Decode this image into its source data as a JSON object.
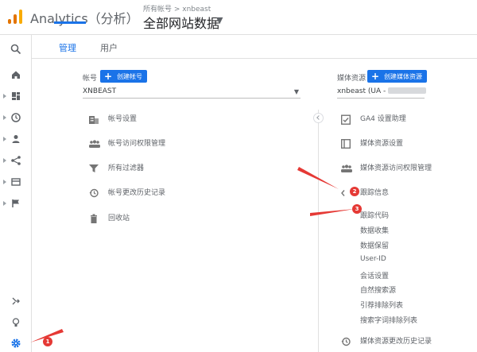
{
  "header": {
    "app_name": "Analytics（分析）",
    "breadcrumb": "所有帐号 > xnbeast",
    "view_name": "全部网站数据"
  },
  "tabs": [
    {
      "label": "管理"
    },
    {
      "label": "用户"
    }
  ],
  "account": {
    "label": "帐号",
    "create_label": "创建帐号",
    "selected": "XNBEAST",
    "items": [
      {
        "label": "帐号设置",
        "icon": "building-icon"
      },
      {
        "label": "帐号访问权限管理",
        "icon": "users-icon"
      },
      {
        "label": "所有过滤器",
        "icon": "filter-icon"
      },
      {
        "label": "帐号更改历史记录",
        "icon": "history-icon"
      },
      {
        "label": "回收站",
        "icon": "trash-icon"
      }
    ]
  },
  "property": {
    "label": "媒体资源",
    "create_label": "创建媒体资源",
    "selected": "xnbeast (UA -",
    "items": [
      {
        "label": "GA4 设置助理",
        "icon": "checklist-icon"
      },
      {
        "label": "媒体资源设置",
        "icon": "window-icon"
      },
      {
        "label": "媒体资源访问权限管理",
        "icon": "users-icon"
      },
      {
        "label": "跟踪信息",
        "icon": "code-icon"
      }
    ],
    "tracking_subitems": [
      {
        "label": "跟踪代码"
      },
      {
        "label": "数据收集"
      },
      {
        "label": "数据保留"
      },
      {
        "label": "User-ID"
      },
      {
        "label": "会话设置"
      },
      {
        "label": "自然搜索源"
      },
      {
        "label": "引荐排除列表"
      },
      {
        "label": "搜索字词排除列表"
      }
    ],
    "history_label": "媒体资源更改历史记录"
  },
  "annotations": {
    "badges": [
      "1",
      "2",
      "3"
    ],
    "color": "#e53935"
  },
  "colors": {
    "accent": "#1a73e8",
    "logo": [
      "#f9ab00",
      "#e37400",
      "#e37400"
    ]
  }
}
